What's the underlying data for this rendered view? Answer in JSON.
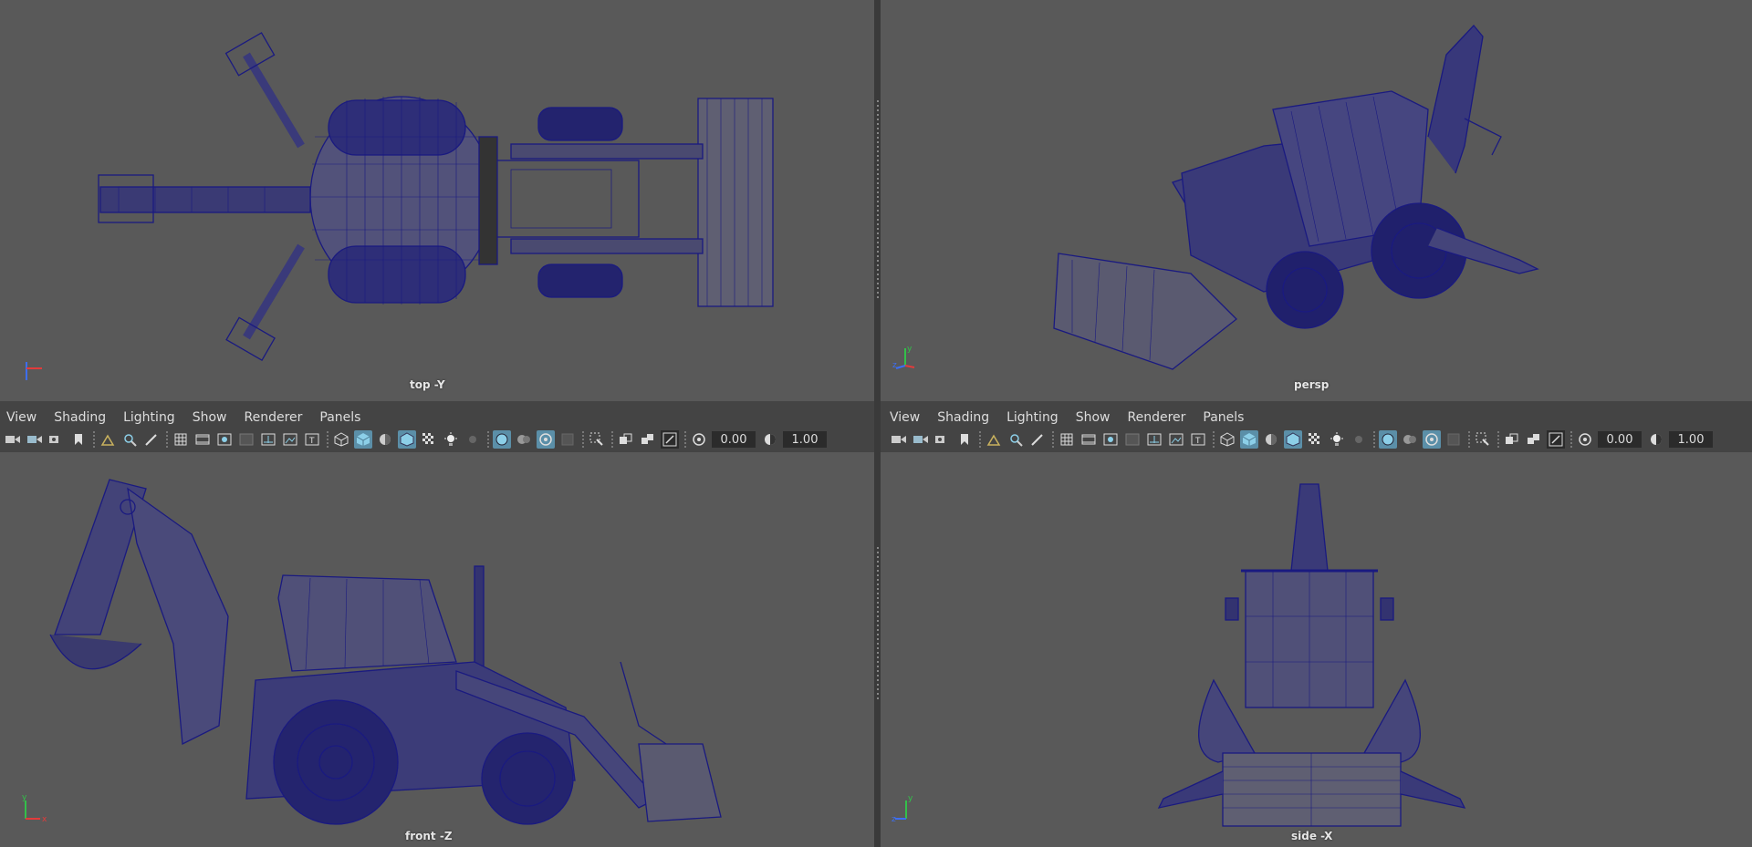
{
  "menu": {
    "view": "View",
    "shading": "Shading",
    "lighting": "Lighting",
    "show": "Show",
    "renderer": "Renderer",
    "panels": "Panels"
  },
  "toolbar": {
    "exposure_value": "0.00",
    "gamma_value": "1.00"
  },
  "viewports": {
    "top": {
      "label": "top -Y",
      "axis": [
        "x",
        "y"
      ]
    },
    "persp": {
      "label": "persp",
      "axis": [
        "y",
        "z"
      ]
    },
    "front": {
      "label": "front -Z",
      "axis": [
        "y",
        "x"
      ]
    },
    "side": {
      "label": "side -X",
      "axis": [
        "y",
        "z"
      ]
    }
  },
  "colors": {
    "viewport_bg": "#595959",
    "wireframe": "#1a1a80",
    "panel_bg": "#444444",
    "active_button": "#5b8fa8"
  },
  "icons": [
    "camera-icon",
    "camera-attributes-icon",
    "bookmark-icon",
    "image-plane-icon",
    "2d-pan-zoom-icon",
    "grease-pencil-icon",
    "grid-icon",
    "film-gate-icon",
    "resolution-gate-icon",
    "gate-mask-icon",
    "field-chart-icon",
    "safe-action-icon",
    "safe-title-icon",
    "wireframe-icon",
    "smooth-shade-icon",
    "default-material-icon",
    "wireframe-on-shaded-icon",
    "textured-icon",
    "use-all-lights-icon",
    "shadows-icon",
    "xray-icon",
    "xray-active-components-icon",
    "xray-joints-icon",
    "backface-culling-icon",
    "isolate-select-icon",
    "screen-space-ao-icon",
    "motion-blur-icon",
    "anti-aliasing-icon",
    "exposure-icon",
    "gamma-icon"
  ]
}
